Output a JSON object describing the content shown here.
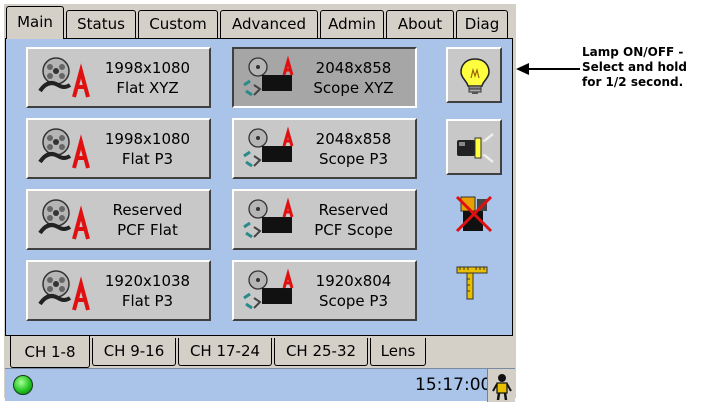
{
  "top_tabs": [
    {
      "label": "Main",
      "active": true
    },
    {
      "label": "Status",
      "active": false
    },
    {
      "label": "Custom",
      "active": false
    },
    {
      "label": "Advanced",
      "active": false
    },
    {
      "label": "Admin",
      "active": false
    },
    {
      "label": "About",
      "active": false
    },
    {
      "label": "Diag",
      "active": false
    }
  ],
  "presets": [
    {
      "line1": "1998x1080",
      "line2": "Flat XYZ",
      "icon": "reel-flat-icon",
      "selected": false
    },
    {
      "line1": "2048x858",
      "line2": "Scope XYZ",
      "icon": "reel-scope-icon",
      "selected": true
    },
    {
      "line1": "1998x1080",
      "line2": "Flat P3",
      "icon": "reel-flat-icon",
      "selected": false
    },
    {
      "line1": "2048x858",
      "line2": "Scope P3",
      "icon": "reel-scope-icon",
      "selected": false
    },
    {
      "line1": "Reserved",
      "line2": "PCF Flat",
      "icon": "reel-flat-icon",
      "selected": false
    },
    {
      "line1": "Reserved",
      "line2": "PCF Scope",
      "icon": "reel-scope-icon",
      "selected": false
    },
    {
      "line1": "1920x1038",
      "line2": "Flat P3",
      "icon": "reel-flat-icon",
      "selected": false
    },
    {
      "line1": "1920x804",
      "line2": "Scope P3",
      "icon": "reel-scope-icon",
      "selected": false
    }
  ],
  "side_buttons": [
    {
      "name": "lamp-toggle-button",
      "icon": "lightbulb-icon"
    },
    {
      "name": "douser-button",
      "icon": "douser-projector-icon"
    },
    {
      "name": "no-test-pattern-button",
      "icon": "test-pattern-off-icon"
    },
    {
      "name": "test-pattern-button",
      "icon": "test-pattern-icon"
    }
  ],
  "bottom_tabs": [
    {
      "label": "CH 1-8",
      "active": true
    },
    {
      "label": "CH 9-16",
      "active": false
    },
    {
      "label": "CH 17-24",
      "active": false
    },
    {
      "label": "CH 25-32",
      "active": false
    },
    {
      "label": "Lens",
      "active": false
    }
  ],
  "status": {
    "time": "15:17:00",
    "led_icon": "status-led-icon",
    "user_icon": "user-icon"
  },
  "annotation": {
    "line1": "Lamp ON/OFF -",
    "line2": "Select and hold",
    "line3": "for 1/2 second."
  },
  "colors": {
    "content_bg": "#a9c4e8",
    "panel_bg": "#d4d0c8",
    "button_bg": "#c8c8c8",
    "selected_button_bg": "#a6a6a6"
  }
}
